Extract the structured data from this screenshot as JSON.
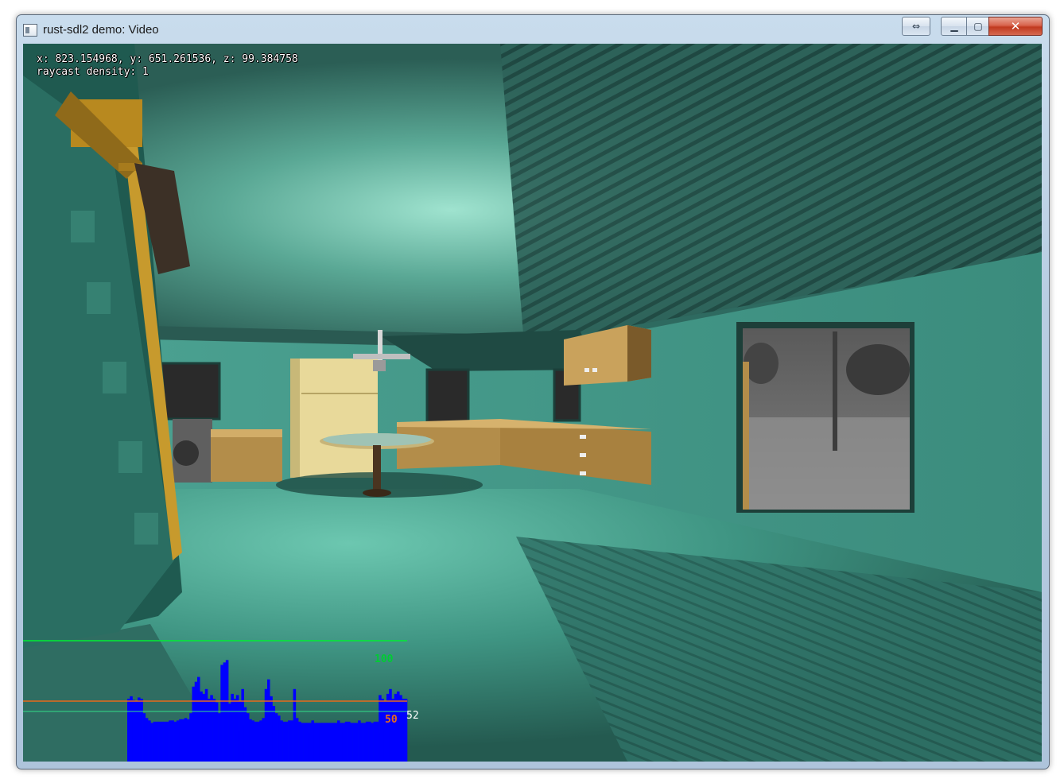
{
  "window": {
    "title": "rust-sdl2 demo: Video",
    "buttons": {
      "alt_icon": "⇔",
      "minimize_icon": "▁",
      "maximize_icon": "▢",
      "close_icon": "✕"
    }
  },
  "hud": {
    "position_line": "x: 823.154968, y: 651.261536, z: 99.384758",
    "density_line": "raycast density: 1"
  },
  "perf_graph": {
    "line_100_label": "100",
    "line_50_label": "50",
    "current_value_label": "52",
    "colors": {
      "bars": "#0000ff",
      "line_100": "#00ee33",
      "line_50": "#e86a1a",
      "baseline": "#33dd88"
    },
    "samples": [
      52,
      54,
      51,
      50,
      53,
      52,
      40,
      36,
      34,
      32,
      33,
      33,
      33,
      33,
      33,
      33,
      34,
      34,
      33,
      34,
      35,
      35,
      36,
      35,
      40,
      62,
      66,
      70,
      58,
      56,
      60,
      52,
      55,
      52,
      49,
      40,
      80,
      82,
      84,
      48,
      56,
      52,
      55,
      50,
      60,
      45,
      40,
      35,
      34,
      33,
      33,
      34,
      36,
      60,
      68,
      54,
      46,
      40,
      38,
      34,
      33,
      33,
      34,
      34,
      60,
      36,
      33,
      32,
      32,
      32,
      32,
      34,
      32,
      32,
      32,
      32,
      32,
      32,
      32,
      32,
      32,
      34,
      32,
      32,
      33,
      33,
      32,
      32,
      32,
      34,
      32,
      32,
      33,
      33,
      32,
      33,
      33,
      55,
      52,
      50,
      56,
      60,
      52,
      56,
      58,
      55,
      52,
      52
    ]
  }
}
